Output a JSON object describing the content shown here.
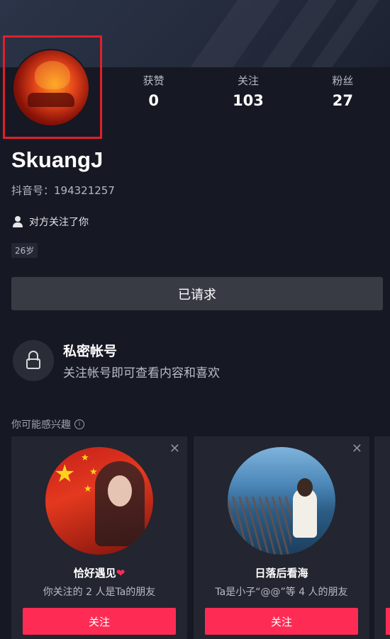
{
  "profile": {
    "stats": [
      {
        "label": "获赞",
        "value": "0"
      },
      {
        "label": "关注",
        "value": "103"
      },
      {
        "label": "粉丝",
        "value": "27"
      }
    ],
    "name": "SkuangJ",
    "douyin_id": "抖音号：194321257",
    "follow_note": "对方关注了你",
    "age": "26岁",
    "requested_label": "已请求"
  },
  "private_account": {
    "title": "私密帐号",
    "subtitle": "关注帐号即可查看内容和喜欢"
  },
  "suggestions": {
    "heading": "你可能感兴趣",
    "cards": [
      {
        "name": "恰好遇见",
        "reason": "你关注的 2 人是Ta的朋友",
        "button": "关注",
        "close": "✕"
      },
      {
        "name": "日落后看海",
        "reason": "Ta是小子“@@”等 4 人的朋友",
        "button": "关注",
        "close": "✕"
      }
    ]
  },
  "colors": {
    "accent": "#fe2c55",
    "highlight_box": "#e0202b",
    "background": "#161823"
  }
}
